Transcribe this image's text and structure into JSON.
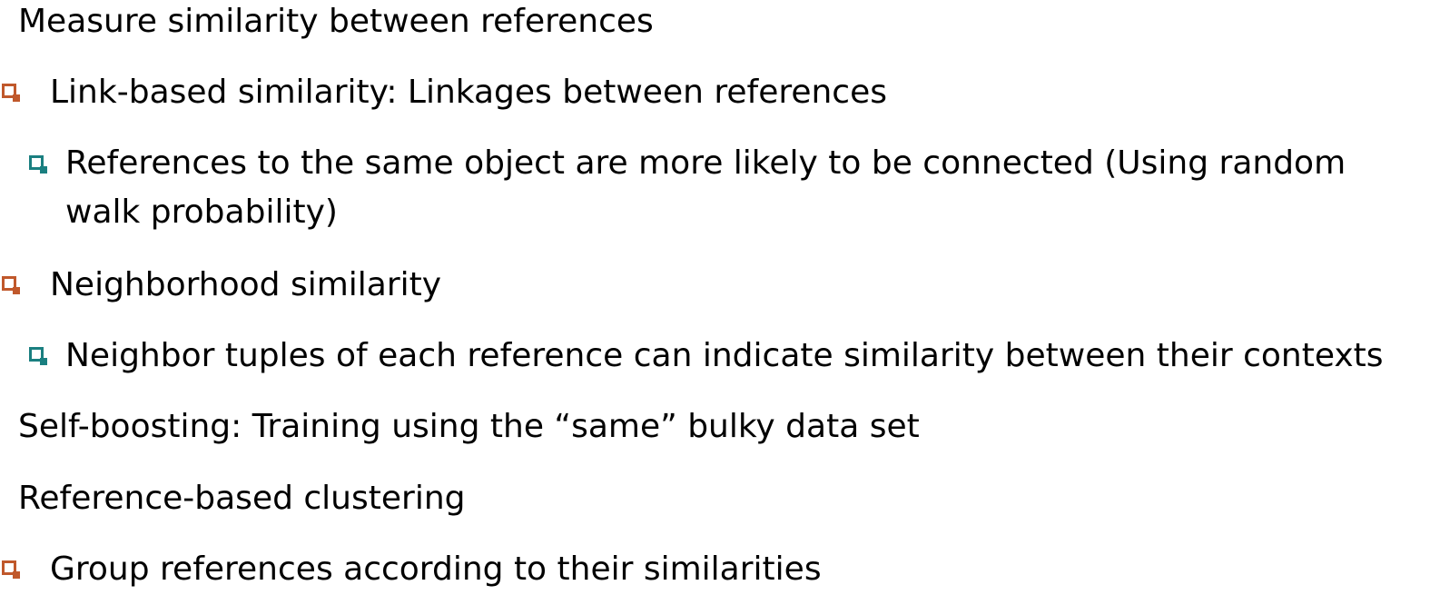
{
  "lines": [
    {
      "text": "Measure similarity between references"
    },
    {
      "text": "Link-based similarity: Linkages between references",
      "bullet_color": "#c0582b"
    },
    {
      "text": "References to the same object are more likely to be connected (Using random walk probability)",
      "bullet_color": "#1a7f80"
    },
    {
      "text": "Neighborhood similarity",
      "bullet_color": "#c0582b"
    },
    {
      "text": "Neighbor tuples of each reference can indicate similarity between their contexts",
      "bullet_color": "#1a7f80"
    },
    {
      "text": "Self-boosting: Training using the “same” bulky data set"
    },
    {
      "text": "Reference-based clustering"
    },
    {
      "text": "Group references according to their similarities",
      "bullet_color": "#c0582b"
    }
  ]
}
